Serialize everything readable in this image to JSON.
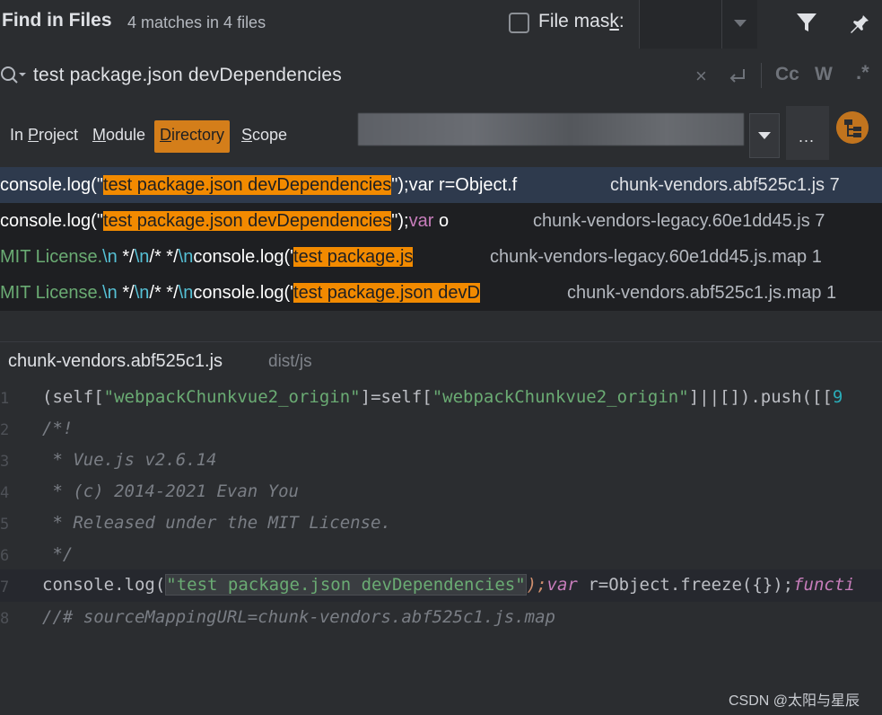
{
  "header": {
    "title": "Find in Files",
    "match_count": "4 matches in 4 files",
    "file_mask_label_pre": "File mas",
    "file_mask_label_u": "k",
    "file_mask_label_post": ":"
  },
  "search": {
    "query": "test package.json devDependencies",
    "toggle_case": "Cc",
    "toggle_words": "W",
    "toggle_regex": ".*"
  },
  "scope": {
    "tabs": [
      {
        "pre": "In ",
        "u": "P",
        "post": "roject"
      },
      {
        "pre": "",
        "u": "M",
        "post": "odule"
      },
      {
        "pre": "",
        "u": "D",
        "post": "irectory"
      },
      {
        "pre": "",
        "u": "S",
        "post": "cope"
      }
    ],
    "active_tab": "Directory",
    "more_label": "..."
  },
  "results": [
    {
      "pre": "console.log(\"",
      "match": "test package.json devDependencies",
      "post": "\");var r=Object.f",
      "file": "chunk-vendors.abf525c1.js 7"
    },
    {
      "pre": "console.log(\"",
      "match": "test package.json devDependencies",
      "post_a": "\");",
      "post_b": "var",
      "post_c": " o",
      "file": "chunk-vendors-legacy.60e1dd45.js 7"
    },
    {
      "pre_a": "MIT License.",
      "pre_b": "\\n",
      "pre_c": " */",
      "pre_d": "\\n",
      "pre_e": "/*  */",
      "pre_f": "\\n",
      "pre_g": "console.log('",
      "match": "test package.js",
      "file": "chunk-vendors-legacy.60e1dd45.js.map 1"
    },
    {
      "pre_a": "MIT License.",
      "pre_b": "\\n",
      "pre_c": " */",
      "pre_d": "\\n",
      "pre_e": "/*  */",
      "pre_f": "\\n",
      "pre_g": "console.log('",
      "match": "test package.json devD",
      "file": "chunk-vendors.abf525c1.js.map 1"
    }
  ],
  "preview": {
    "file_name": "chunk-vendors.abf525c1.js",
    "file_path": "dist/js",
    "line_numbers": [
      "1",
      "2",
      "3",
      "4",
      "5",
      "6",
      "7",
      "8"
    ],
    "line1": {
      "a": "(self[",
      "b": "\"webpackChunkvue2_origin\"",
      "c": "]=self[",
      "d": "\"webpackChunkvue2_origin\"",
      "e": "]||[]).push([[",
      "f": "9"
    },
    "line2": "/*!",
    "line3": " * Vue.js v2.6.14",
    "line4": " * (c) 2014-2021 Evan You",
    "line5": " * Released under the MIT License.",
    "line6": " */",
    "line7": {
      "a": "console.log(",
      "b": "\"test package.json devDependencies\"",
      "c": ");",
      "d": "var",
      "e": " r=Object.freeze({});",
      "f": "functi"
    },
    "line8": "//# sourceMappingURL=chunk-vendors.abf525c1.js.map"
  },
  "watermark": "CSDN @太阳与星辰",
  "colors": {
    "highlight": "#f28a00",
    "active_tab": "#d47e1a",
    "background": "#2b2d30"
  }
}
